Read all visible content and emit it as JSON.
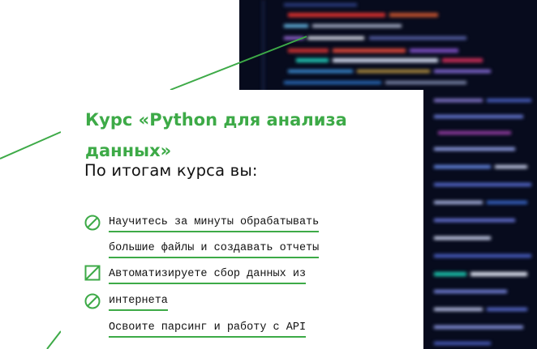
{
  "course": {
    "title": "Курс «Python для анализа данных»",
    "subtitle": "По итогам курса вы:"
  },
  "benefits": [
    {
      "lines": [
        "Научитесь за минуты обрабатывать",
        "большие файлы и создавать отчеты"
      ],
      "icon": "no-entry-circle-icon"
    },
    {
      "lines": [
        "Автоматизируете сбор данных из",
        "интернета"
      ],
      "icon": "crossed-square-icon"
    },
    {
      "lines": [
        "Освоите парсинг и работу с API"
      ],
      "icon": "no-entry-circle-icon"
    }
  ],
  "colors": {
    "accent": "#3daa47",
    "text": "#111111",
    "photo_bg": "#070b1d"
  }
}
